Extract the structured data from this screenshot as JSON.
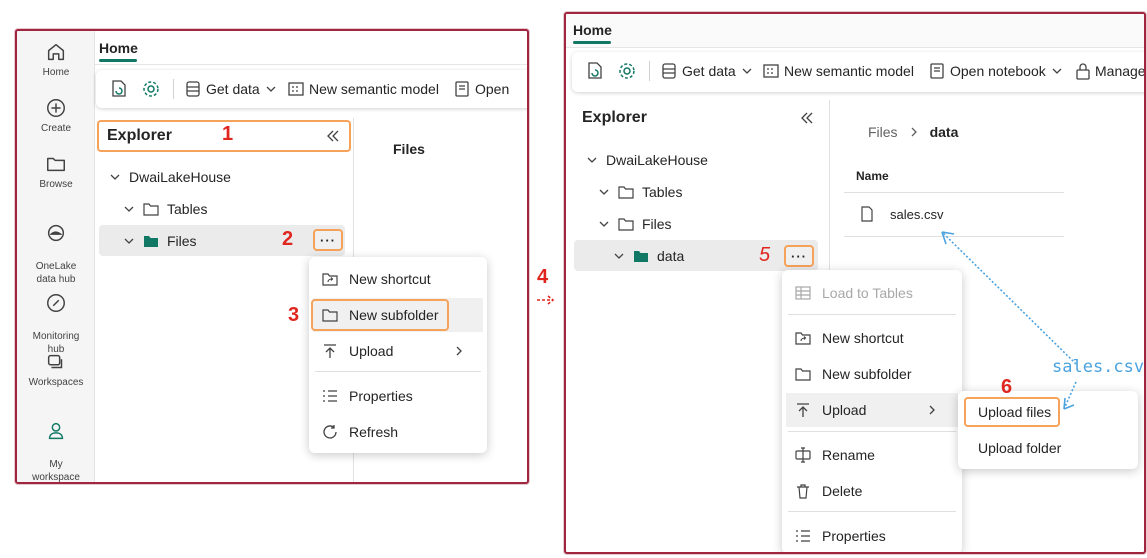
{
  "left": {
    "nav": [
      {
        "label": "Home",
        "icon": "home-icon"
      },
      {
        "label": "Create",
        "icon": "plus-circle-icon"
      },
      {
        "label": "Browse",
        "icon": "folder-icon"
      },
      {
        "label": "OneLake\ndata hub",
        "icon": "onelake-icon"
      },
      {
        "label": "Monitoring\nhub",
        "icon": "monitoring-icon"
      },
      {
        "label": "Workspaces",
        "icon": "workspaces-icon"
      },
      {
        "label": "My\nworkspace",
        "icon": "user-icon"
      }
    ],
    "tab": "Home",
    "toolbar": {
      "get_data": "Get data",
      "new_semantic_model": "New semantic model",
      "open": "Open"
    },
    "explorer": "Explorer",
    "content_header": "Files",
    "tree": {
      "root": "DwaiLakeHouse",
      "tables": "Tables",
      "files": "Files"
    },
    "menu": {
      "new_shortcut": "New shortcut",
      "new_subfolder": "New subfolder",
      "upload": "Upload",
      "properties": "Properties",
      "refresh": "Refresh"
    },
    "steps": {
      "s1": "1",
      "s2": "2",
      "s3": "3"
    }
  },
  "step4": "4",
  "right": {
    "tab": "Home",
    "toolbar": {
      "get_data": "Get data",
      "new_semantic_model": "New semantic model",
      "open_notebook": "Open notebook",
      "manage": "Manage"
    },
    "explorer": "Explorer",
    "tree": {
      "root": "DwaiLakeHouse",
      "tables": "Tables",
      "files": "Files",
      "data": "data"
    },
    "breadcrumb": {
      "files": "Files",
      "data": "data"
    },
    "column_name": "Name",
    "file": "sales.csv",
    "menu": {
      "load_to_tables": "Load to Tables",
      "new_shortcut": "New shortcut",
      "new_subfolder": "New subfolder",
      "upload": "Upload",
      "rename": "Rename",
      "delete": "Delete",
      "properties": "Properties"
    },
    "submenu": {
      "upload_files": "Upload files",
      "upload_folder": "Upload folder"
    },
    "annotation": "sales.csv",
    "steps": {
      "s5": "5",
      "s6": "6"
    }
  },
  "colors": {
    "accent": "#117865",
    "frame": "#a0253f",
    "highlight": "#f5a25a",
    "step": "#e0261f",
    "arrow": "#4aa3df"
  }
}
